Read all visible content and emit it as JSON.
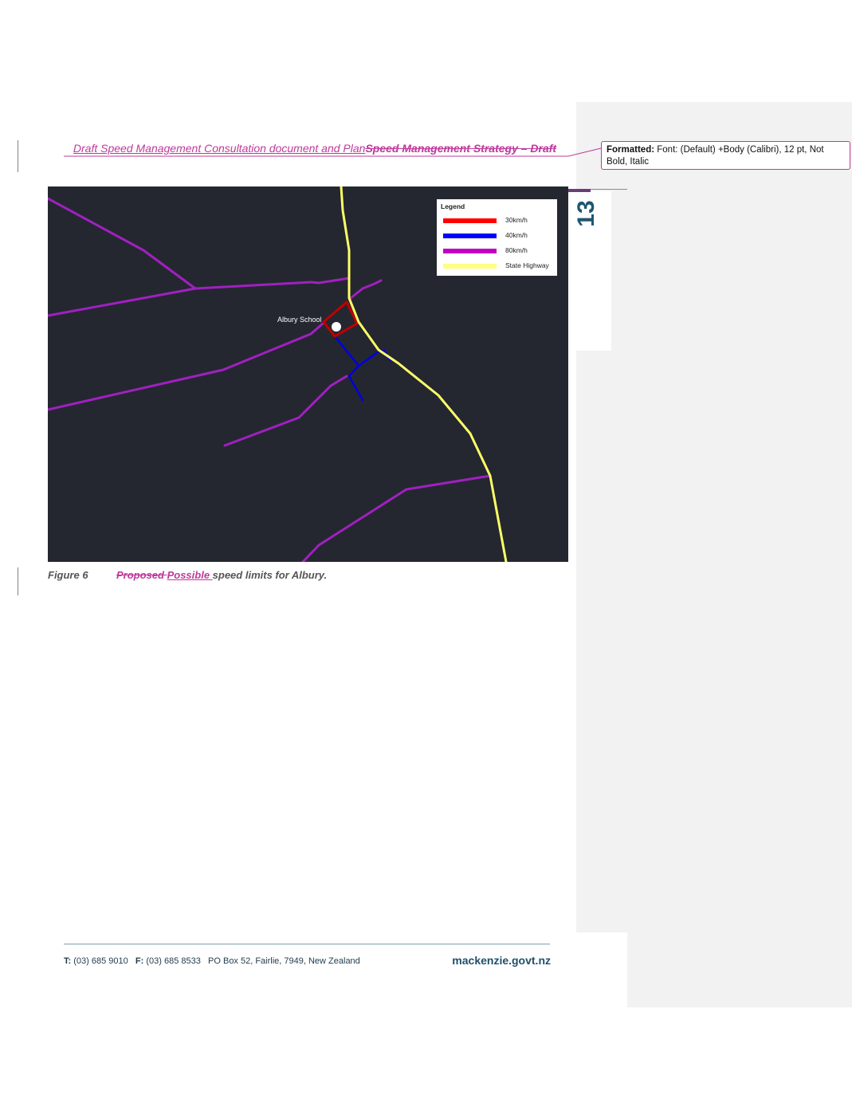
{
  "header": {
    "inserted_text": "Draft Speed Management Consultation document and Plan",
    "deleted_text": "Speed Management Strategy – Draft"
  },
  "page_number": "13",
  "comment": {
    "label": "Formatted:",
    "text": "Font: (Default) +Body (Calibri), 12 pt, Not Bold, Italic"
  },
  "map": {
    "legend_title": "Legend",
    "legend_items": [
      {
        "label": "30km/h",
        "color": "#ff0000"
      },
      {
        "label": "40km/h",
        "color": "#0000ff"
      },
      {
        "label": "80km/h",
        "color": "#c000c0"
      },
      {
        "label": "State Highway",
        "color": "#ffff80"
      }
    ],
    "place_label": "Albury School",
    "colors": {
      "background": "#242730",
      "road_30": "#e00000",
      "road_40": "#0000e0",
      "road_80": "#a020c0",
      "state_highway": "#ffff66"
    }
  },
  "caption": {
    "figure_label": "Figure 6",
    "deleted_word": "Proposed ",
    "inserted_word": "Possible ",
    "rest": "speed limits for Albury."
  },
  "footer": {
    "t_label": "T:",
    "t_value": "(03) 685 9010",
    "f_label": "F:",
    "f_value": "(03) 685 8533",
    "address": "PO Box 52, Fairlie, 7949, New Zealand",
    "brand": "mackenzie.govt.nz"
  }
}
